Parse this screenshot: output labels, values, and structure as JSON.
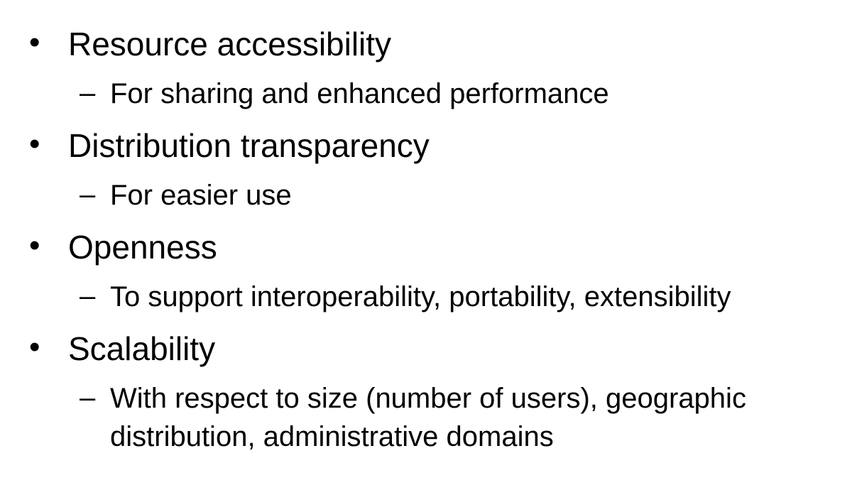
{
  "bullets": [
    {
      "label": "Resource accessibility",
      "sub": "For sharing and enhanced performance"
    },
    {
      "label": "Distribution transparency",
      "sub": "For easier use"
    },
    {
      "label": "Openness",
      "sub": "To support interoperability, portability, extensibility"
    },
    {
      "label": "Scalability",
      "sub": "With respect to size (number of users), geographic distribution, administrative domains"
    }
  ],
  "bullet_symbol": "•",
  "sub_symbol": "–"
}
